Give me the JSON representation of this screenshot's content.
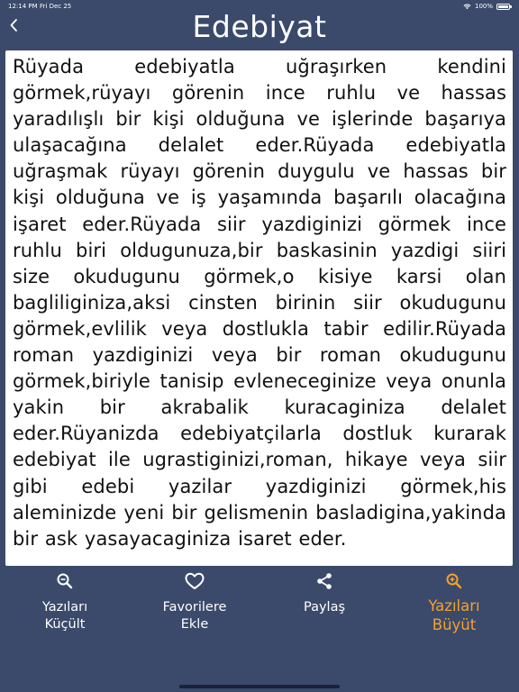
{
  "status": {
    "time": "12:14 PM",
    "date": "Fri Dec 25",
    "battery": "100%"
  },
  "nav": {
    "title": "Edebiyat",
    "back_icon": "chevron-left-icon"
  },
  "content": {
    "text": "Rüyada edebiyatla uğraşırken kendini görmek,rüyayı görenin ince ruhlu ve hassas yaradılışlı bir kişi olduğuna ve işlerinde başarıya ulaşacağına delalet eder.Rüyada edebiyatla uğraşmak rüyayı görenin duygulu ve hassas bir kişi olduğuna ve iş yaşamında başarılı olacağına işaret eder.Rüyada siir yazdiginizi görmek ince ruhlu biri oldugunuza,bir baskasinin yazdigi siiri size okudugunu görmek,o kisiye karsi olan bagliliginiza,aksi cinsten birinin siir okudugunu görmek,evlilik veya dostlukla tabir edilir.Rüyada roman yazdiginizi veya bir roman okudugunu görmek,biriyle tanisip evleneceginize veya onunla yakin bir akrabalik kuracaginiza delalet eder.Rüyanizda edebiyatçilarla dostluk kurarak edebiyat ile ugrastiginizi,roman, hikaye veya siir gibi edebi yazilar yazdiginizi görmek,his aleminizde yeni bir gelismenin basladigina,yakinda bir ask yasayacaginiza isaret eder."
  },
  "tabs": [
    {
      "id": "shrink",
      "icon": "zoom-out-icon",
      "label": "Yazıları\nKüçült",
      "active": false
    },
    {
      "id": "favorite",
      "icon": "heart-icon",
      "label": "Favorilere\nEkle",
      "active": false
    },
    {
      "id": "share",
      "icon": "share-icon",
      "label": "Paylaş",
      "active": false
    },
    {
      "id": "enlarge",
      "icon": "zoom-in-icon",
      "label": "Yazıları\nBüyüt",
      "active": true
    }
  ],
  "colors": {
    "background": "#3b4a6b",
    "content_bg": "#ffffff",
    "accent": "#f3a12c"
  }
}
